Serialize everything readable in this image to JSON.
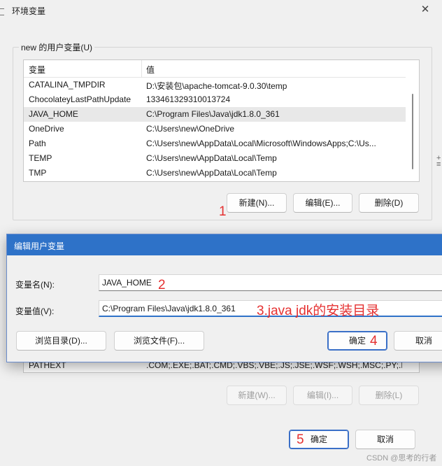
{
  "window": {
    "title": "环境变量",
    "close_glyph": "✕"
  },
  "user_vars": {
    "group_label": "new 的用户变量(U)",
    "columns": [
      "变量",
      "值"
    ],
    "rows": [
      {
        "name": "CATALINA_TMPDIR",
        "value": "D:\\安装包\\apache-tomcat-9.0.30\\temp"
      },
      {
        "name": "ChocolateyLastPathUpdate",
        "value": "133461329310013724"
      },
      {
        "name": "JAVA_HOME",
        "value": "C:\\Program Files\\Java\\jdk1.8.0_361"
      },
      {
        "name": "OneDrive",
        "value": "C:\\Users\\new\\OneDrive"
      },
      {
        "name": "Path",
        "value": "C:\\Users\\new\\AppData\\Local\\Microsoft\\WindowsApps;C:\\Us..."
      },
      {
        "name": "TEMP",
        "value": "C:\\Users\\new\\AppData\\Local\\Temp"
      },
      {
        "name": "TMP",
        "value": "C:\\Users\\new\\AppData\\Local\\Temp"
      }
    ],
    "new_label": "新建(N)...",
    "edit_label": "编辑(E)...",
    "delete_label": "删除(D)"
  },
  "system_vars": {
    "visible_row": {
      "name": "PATHEXT",
      "value": ".COM;.EXE;.BAT;.CMD;.VBS;.VBE;.JS;.JSE;.WSF;.WSH;.MSC;.PY;.P..."
    },
    "new_label": "新建(W)...",
    "edit_label": "编辑(I)...",
    "delete_label": "删除(L)"
  },
  "footer": {
    "ok_label": "确定",
    "cancel_label": "取消"
  },
  "edit_dialog": {
    "title": "编辑用户变量",
    "name_label": "变量名(N):",
    "name_value": "JAVA_HOME",
    "value_label": "变量值(V):",
    "value_value": "C:\\Program Files\\Java\\jdk1.8.0_361",
    "browse_dir_label": "浏览目录(D)...",
    "browse_file_label": "浏览文件(F)...",
    "ok_label": "确定",
    "cancel_label": "取消"
  },
  "annotations": {
    "step1": "1",
    "step2": "2",
    "step3": "3.java jdk的安装目录",
    "step4": "4",
    "step5": "5",
    "color": "#e53030"
  },
  "watermark": "CSDN @思考的行者",
  "colors": {
    "accent": "#2e72c8",
    "selection": "#e8e8e8"
  }
}
